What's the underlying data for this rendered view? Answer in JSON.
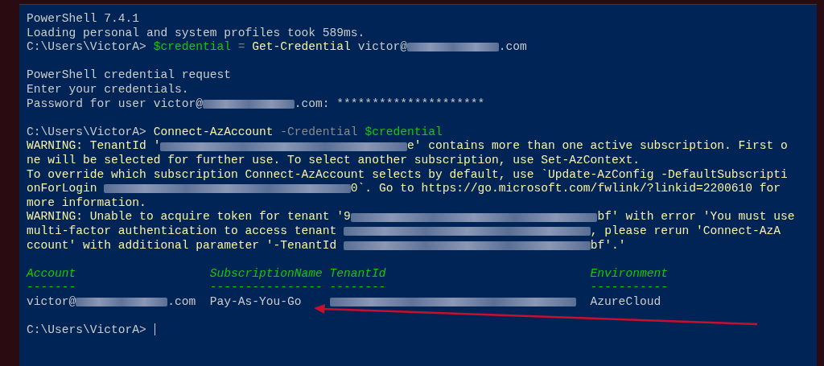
{
  "terminal": {
    "blocks": [
      {
        "kind": "line",
        "segments": [
          {
            "kind": "plain",
            "text": "PowerShell 7.4.1"
          }
        ]
      },
      {
        "kind": "line",
        "segments": [
          {
            "kind": "plain",
            "text": "Loading personal and system profiles took 589ms."
          }
        ]
      },
      {
        "kind": "line",
        "segments": [
          {
            "kind": "prompt",
            "text": "C:\\Users\\VictorA> "
          },
          {
            "kind": "variable",
            "text": "$credential"
          },
          {
            "kind": "operator",
            "text": " = "
          },
          {
            "kind": "command",
            "text": "Get-Credential"
          },
          {
            "kind": "plain",
            "text": " victor@"
          },
          {
            "kind": "redacted_short"
          },
          {
            "kind": "plain",
            "text": ".com"
          }
        ]
      },
      {
        "kind": "blank"
      },
      {
        "kind": "line",
        "segments": [
          {
            "kind": "plain",
            "text": "PowerShell credential request"
          }
        ]
      },
      {
        "kind": "line",
        "segments": [
          {
            "kind": "plain",
            "text": "Enter your credentials."
          }
        ]
      },
      {
        "kind": "line",
        "segments": [
          {
            "kind": "plain",
            "text": "Password for user victor@"
          },
          {
            "kind": "redacted_short"
          },
          {
            "kind": "plain",
            "text": ".com: *********************"
          }
        ]
      },
      {
        "kind": "blank"
      },
      {
        "kind": "line",
        "segments": [
          {
            "kind": "prompt",
            "text": "C:\\Users\\VictorA> "
          },
          {
            "kind": "command",
            "text": "Connect-AzAccount"
          },
          {
            "kind": "parameter",
            "text": " -Credential "
          },
          {
            "kind": "variable",
            "text": "$credential"
          }
        ]
      },
      {
        "kind": "line",
        "segments": [
          {
            "kind": "warning",
            "text": "WARNING: TenantId '"
          },
          {
            "kind": "redacted_long"
          },
          {
            "kind": "warning",
            "text": "e' contains more than one active subscription. First o"
          }
        ]
      },
      {
        "kind": "line",
        "segments": [
          {
            "kind": "warning",
            "text": "ne will be selected for further use. To select another subscription, use Set-AzContext."
          }
        ]
      },
      {
        "kind": "line",
        "segments": [
          {
            "kind": "warning",
            "text": "To override which subscription Connect-AzAccount selects by default, use `Update-AzConfig -DefaultSubscripti"
          }
        ]
      },
      {
        "kind": "line",
        "segments": [
          {
            "kind": "warning",
            "text": "onForLogin "
          },
          {
            "kind": "redacted_long"
          },
          {
            "kind": "warning",
            "text": "0`. Go to https://go.microsoft.com/fwlink/?linkid=2200610 for"
          }
        ]
      },
      {
        "kind": "line",
        "segments": [
          {
            "kind": "warning",
            "text": "more information."
          }
        ]
      },
      {
        "kind": "line",
        "segments": [
          {
            "kind": "warning",
            "text": "WARNING: Unable to acquire token for tenant '9"
          },
          {
            "kind": "redacted_long"
          },
          {
            "kind": "warning",
            "text": "bf' with error 'You must use"
          }
        ]
      },
      {
        "kind": "line",
        "segments": [
          {
            "kind": "warning",
            "text": "multi-factor authentication to access tenant "
          },
          {
            "kind": "redacted_long"
          },
          {
            "kind": "warning",
            "text": ", please rerun 'Connect-AzA"
          }
        ]
      },
      {
        "kind": "line",
        "segments": [
          {
            "kind": "warning",
            "text": "ccount' with additional parameter '-TenantId "
          },
          {
            "kind": "redacted_long"
          },
          {
            "kind": "warning",
            "text": "bf'.'"
          }
        ]
      },
      {
        "kind": "blank"
      },
      {
        "kind": "table",
        "columns": [
          {
            "header": "Account",
            "rule": "-------"
          },
          {
            "header": "SubscriptionName",
            "rule": "----------------"
          },
          {
            "header": "TenantId",
            "rule": "--------"
          },
          {
            "header": "Environment",
            "rule": "-----------"
          }
        ],
        "rows": [
          {
            "cells": [
              [
                {
                  "kind": "plain",
                  "text": "victor@"
                },
                {
                  "kind": "redacted_short"
                },
                {
                  "kind": "plain",
                  "text": ".com"
                }
              ],
              [
                {
                  "kind": "plain",
                  "text": "Pay-As-You-Go"
                }
              ],
              [
                {
                  "kind": "redacted_long"
                }
              ],
              [
                {
                  "kind": "plain",
                  "text": "AzureCloud"
                }
              ]
            ]
          }
        ]
      },
      {
        "kind": "blank"
      },
      {
        "kind": "line",
        "segments": [
          {
            "kind": "prompt",
            "text": "C:\\Users\\VictorA> "
          },
          {
            "kind": "cursor"
          }
        ]
      }
    ]
  }
}
